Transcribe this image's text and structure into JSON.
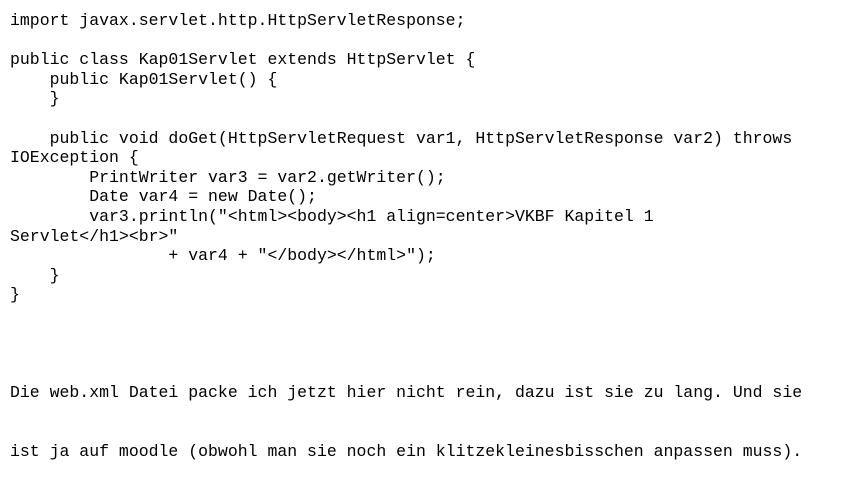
{
  "code_lines": [
    "import javax.servlet.http.HttpServletResponse;",
    "",
    "public class Kap01Servlet extends HttpServlet {",
    "    public Kap01Servlet() {",
    "    }",
    "",
    "    public void doGet(HttpServletRequest var1, HttpServletResponse var2) throws",
    "IOException {",
    "        PrintWriter var3 = var2.getWriter();",
    "        Date var4 = new Date();",
    "        var3.println(\"<html><body><h1 align=center>VKBF Kapitel 1",
    "Servlet</h1><br>\"",
    "                + var4 + \"</body></html>\");",
    "    }",
    "}"
  ],
  "note_lines": [
    "Die web.xml Datei packe ich jetzt hier nicht rein, dazu ist sie zu lang. Und sie",
    "ist ja auf moodle (obwohl man sie noch ein klitzekleinesbisschen anpassen muss)."
  ]
}
